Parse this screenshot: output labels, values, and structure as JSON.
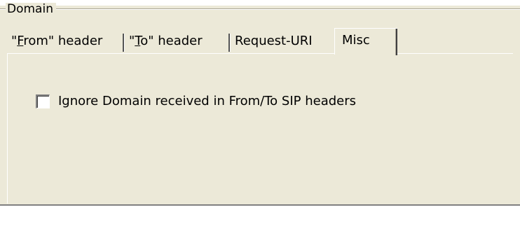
{
  "group": {
    "legend": "Domain"
  },
  "tabs": [
    {
      "mnemonic_prefix": "\"",
      "mnemonic": "F",
      "rest": "rom\" header"
    },
    {
      "mnemonic_prefix": "\"",
      "mnemonic": "T",
      "rest": "o\" header"
    },
    {
      "label": "Request-URI"
    },
    {
      "label": "Misc",
      "selected": true
    }
  ],
  "misc": {
    "ignore_domain_checkbox": {
      "label": "Ignore Domain received in From/To SIP headers",
      "checked": false
    }
  },
  "colors": {
    "face": "#ece9d8",
    "shadow": "#808080",
    "highlight": "#ffffff"
  }
}
